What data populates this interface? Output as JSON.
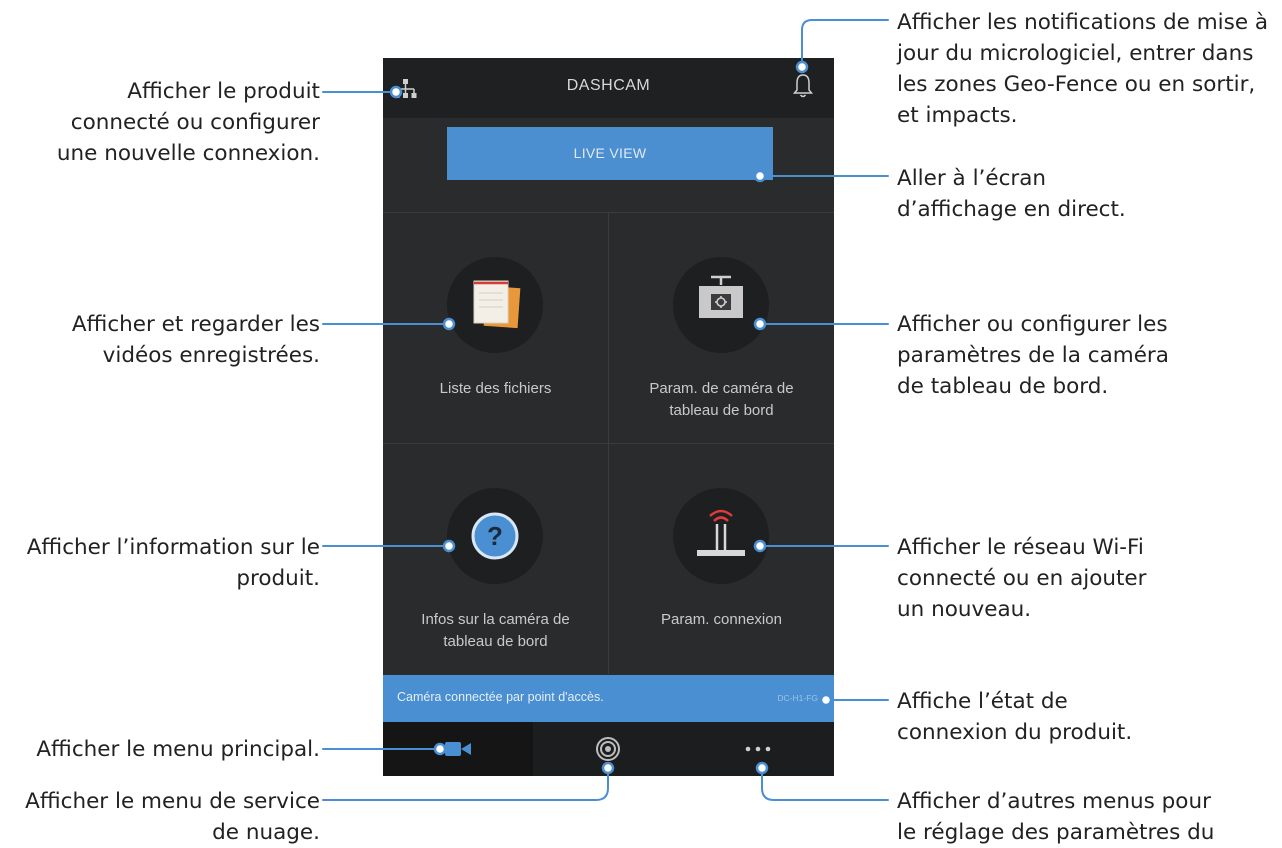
{
  "app": {
    "title": "DASHCAM",
    "live_view_label": "LIVE VIEW",
    "tiles": [
      {
        "label": "Liste des fichiers",
        "icon": "file-list-icon"
      },
      {
        "label": "Param. de caméra de\ntableau de bord",
        "icon": "dashcam-settings-icon"
      },
      {
        "label": "Infos sur la caméra de\ntableau de bord",
        "icon": "help-icon"
      },
      {
        "label": "Param. connexion",
        "icon": "wifi-router-icon"
      }
    ],
    "status": {
      "text": "Caméra connectée par point d'accès.",
      "device_id": "DC-H1-FG"
    },
    "nav": [
      {
        "name": "dashcam-icon",
        "active": true
      },
      {
        "name": "cloud-service-icon",
        "active": false
      },
      {
        "name": "more-icon",
        "active": false
      }
    ]
  },
  "annotations": {
    "network": "Afficher le produit\nconnecté ou configurer\nune nouvelle connexion.",
    "notifications": "Afficher les notifications de mise à\njour du micrologiciel, entrer dans\nles zones Geo-Fence ou en sortir,\net impacts.",
    "live_view": "Aller à l’écran\nd’affichage en direct.",
    "file_list": "Afficher et regarder les\nvidéos enregistrées.",
    "camera_settings": "Afficher ou configurer les\nparamètres de la caméra\nde tableau de bord.",
    "camera_info": "Afficher l’information sur le\nproduit.",
    "wifi": "Afficher le réseau Wi-Fi\nconnecté ou en ajouter\nun nouveau.",
    "connection_status": "Affiche l’état de\nconnexion du produit.",
    "main_menu": "Afficher le menu principal.",
    "cloud_menu": "Afficher le menu de service\nde nuage.",
    "other_menus": "Afficher d’autres menus pour\nle réglage des paramètres du"
  },
  "colors": {
    "accent_blue": "#4a8fd1",
    "background_dark": "#2a2b2d",
    "file_orange": "#e8983a"
  }
}
